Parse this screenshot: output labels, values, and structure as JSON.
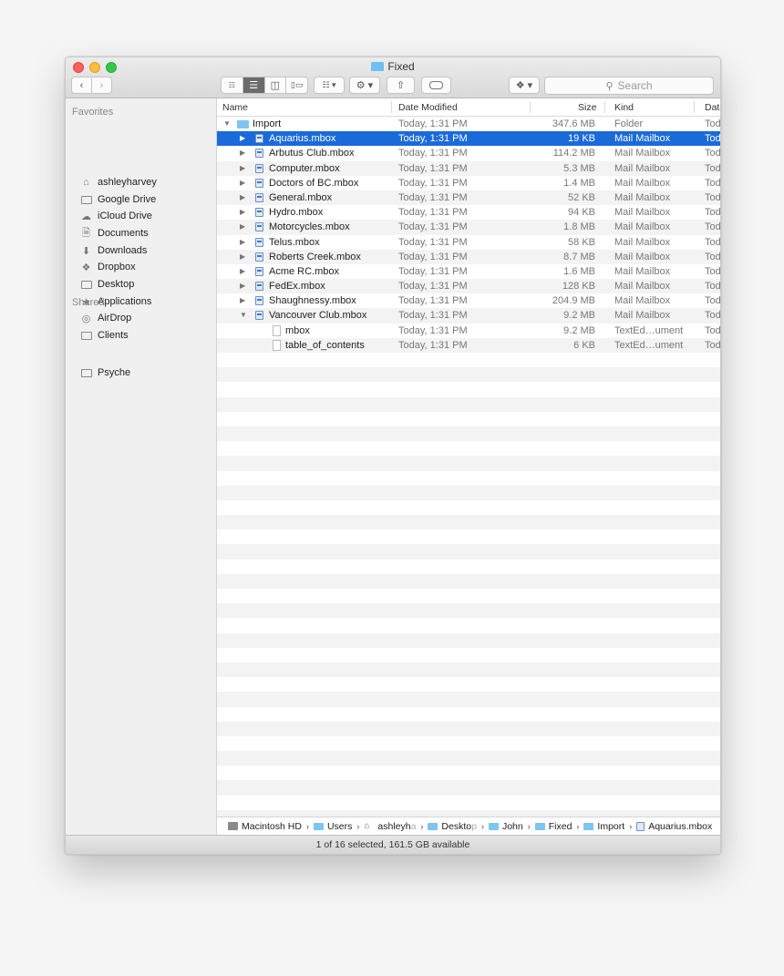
{
  "window": {
    "title": "Fixed",
    "search_placeholder": "Search",
    "toolbar_icons": [
      "back-icon",
      "forward-icon",
      "icon-view-icon",
      "list-view-icon",
      "column-view-icon",
      "cover-flow-icon",
      "arrange-icon",
      "action-gear-icon",
      "share-icon",
      "tag-icon",
      "dropbox-icon"
    ]
  },
  "sidebar": {
    "favorites_header": "Favorites",
    "favorites": [
      {
        "label": "ashleyharvey",
        "icon": "home-icon"
      },
      {
        "label": "Google Drive",
        "icon": "folder-icon"
      },
      {
        "label": "iCloud Drive",
        "icon": "cloud-icon"
      },
      {
        "label": "Documents",
        "icon": "documents-icon"
      },
      {
        "label": "Downloads",
        "icon": "downloads-icon"
      },
      {
        "label": "Dropbox",
        "icon": "dropbox-icon"
      },
      {
        "label": "Desktop",
        "icon": "desktop-icon"
      },
      {
        "label": "Applications",
        "icon": "applications-icon"
      },
      {
        "label": "AirDrop",
        "icon": "airdrop-icon"
      },
      {
        "label": "Clients",
        "icon": "folder-icon"
      }
    ],
    "shared_header": "Shared",
    "shared": [
      {
        "label": "Psyche",
        "icon": "computer-icon"
      }
    ]
  },
  "columns": {
    "name": "Name",
    "date": "Date Modified",
    "size": "Size",
    "kind": "Kind",
    "date2": "Date"
  },
  "rows": [
    {
      "indent": 0,
      "disclosure": "▼",
      "icon": "folder",
      "name": "Import",
      "date": "Today, 1:31 PM",
      "size": "347.6 MB",
      "kind": "Folder",
      "date2": "Tod"
    },
    {
      "indent": 1,
      "disclosure": "▶",
      "icon": "mbox",
      "name": "Aquarius.mbox",
      "date": "Today, 1:31 PM",
      "size": "19 KB",
      "kind": "Mail Mailbox",
      "date2": "Tod",
      "selected": true
    },
    {
      "indent": 1,
      "disclosure": "▶",
      "icon": "mbox",
      "name": "Arbutus Club.mbox",
      "date": "Today, 1:31 PM",
      "size": "114.2 MB",
      "kind": "Mail Mailbox",
      "date2": "Tod"
    },
    {
      "indent": 1,
      "disclosure": "▶",
      "icon": "mbox",
      "name": "Computer.mbox",
      "date": "Today, 1:31 PM",
      "size": "5.3 MB",
      "kind": "Mail Mailbox",
      "date2": "Tod"
    },
    {
      "indent": 1,
      "disclosure": "▶",
      "icon": "mbox",
      "name": "Doctors of BC.mbox",
      "date": "Today, 1:31 PM",
      "size": "1.4 MB",
      "kind": "Mail Mailbox",
      "date2": "Tod"
    },
    {
      "indent": 1,
      "disclosure": "▶",
      "icon": "mbox",
      "name": "General.mbox",
      "date": "Today, 1:31 PM",
      "size": "52 KB",
      "kind": "Mail Mailbox",
      "date2": "Tod"
    },
    {
      "indent": 1,
      "disclosure": "▶",
      "icon": "mbox",
      "name": "Hydro.mbox",
      "date": "Today, 1:31 PM",
      "size": "94 KB",
      "kind": "Mail Mailbox",
      "date2": "Tod"
    },
    {
      "indent": 1,
      "disclosure": "▶",
      "icon": "mbox",
      "name": "Motorcycles.mbox",
      "date": "Today, 1:31 PM",
      "size": "1.8 MB",
      "kind": "Mail Mailbox",
      "date2": "Tod"
    },
    {
      "indent": 1,
      "disclosure": "▶",
      "icon": "mbox",
      "name": "Telus.mbox",
      "date": "Today, 1:31 PM",
      "size": "58 KB",
      "kind": "Mail Mailbox",
      "date2": "Tod"
    },
    {
      "indent": 1,
      "disclosure": "▶",
      "icon": "mbox",
      "name": "Roberts Creek.mbox",
      "date": "Today, 1:31 PM",
      "size": "8.7 MB",
      "kind": "Mail Mailbox",
      "date2": "Tod"
    },
    {
      "indent": 1,
      "disclosure": "▶",
      "icon": "mbox",
      "name": "Acme RC.mbox",
      "date": "Today, 1:31 PM",
      "size": "1.6 MB",
      "kind": "Mail Mailbox",
      "date2": "Tod"
    },
    {
      "indent": 1,
      "disclosure": "▶",
      "icon": "mbox",
      "name": "FedEx.mbox",
      "date": "Today, 1:31 PM",
      "size": "128 KB",
      "kind": "Mail Mailbox",
      "date2": "Tod"
    },
    {
      "indent": 1,
      "disclosure": "▶",
      "icon": "mbox",
      "name": "Shaughnessy.mbox",
      "date": "Today, 1:31 PM",
      "size": "204.9 MB",
      "kind": "Mail Mailbox",
      "date2": "Tod"
    },
    {
      "indent": 1,
      "disclosure": "▼",
      "icon": "mbox",
      "name": "Vancouver Club.mbox",
      "date": "Today, 1:31 PM",
      "size": "9.2 MB",
      "kind": "Mail Mailbox",
      "date2": "Tod"
    },
    {
      "indent": 2,
      "disclosure": "",
      "icon": "doc",
      "name": "mbox",
      "date": "Today, 1:31 PM",
      "size": "9.2 MB",
      "kind": "TextEd…ument",
      "date2": "Tod"
    },
    {
      "indent": 2,
      "disclosure": "",
      "icon": "doc",
      "name": "table_of_contents",
      "date": "Today, 1:31 PM",
      "size": "6 KB",
      "kind": "TextEd…ument",
      "date2": "Tod"
    }
  ],
  "path": [
    {
      "label": "Macintosh HD",
      "icon": "hd"
    },
    {
      "label": "Users",
      "icon": "folder"
    },
    {
      "label": "ashleyh",
      "fade": "a",
      "icon": "home"
    },
    {
      "label": "Deskto",
      "fade": "p",
      "icon": "folder"
    },
    {
      "label": "John",
      "icon": "folder"
    },
    {
      "label": "Fixed",
      "icon": "folder"
    },
    {
      "label": "Import",
      "icon": "folder"
    },
    {
      "label": "Aquarius.mbox",
      "icon": "mbox"
    }
  ],
  "status": "1 of 16 selected, 161.5 GB available",
  "colors": {
    "selection": "#1b6ad9",
    "folder": "#7ec5f2"
  }
}
